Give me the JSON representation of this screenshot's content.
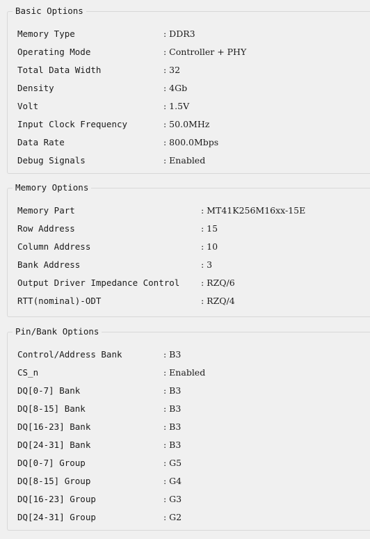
{
  "basic_options": {
    "title": "Basic Options",
    "rows": [
      {
        "label": "Memory Type",
        "value": ": DDR3"
      },
      {
        "label": "Operating Mode",
        "value": ": Controller + PHY"
      },
      {
        "label": "Total Data Width",
        "value": ": 32"
      },
      {
        "label": "Density",
        "value": ": 4Gb"
      },
      {
        "label": "Volt",
        "value": ": 1.5V"
      },
      {
        "label": "Input Clock Frequency",
        "value": ": 50.0MHz"
      },
      {
        "label": "Data Rate",
        "value": ": 800.0Mbps"
      },
      {
        "label": "Debug Signals",
        "value": ": Enabled"
      }
    ]
  },
  "memory_options": {
    "title": "Memory Options",
    "rows": [
      {
        "label": "Memory Part",
        "value": ": MT41K256M16xx-15E"
      },
      {
        "label": "Row Address",
        "value": ": 15"
      },
      {
        "label": "Column Address",
        "value": ": 10"
      },
      {
        "label": "Bank Address",
        "value": ": 3"
      },
      {
        "label": "Output Driver Impedance Control",
        "value": ": RZQ/6"
      },
      {
        "label": "RTT(nominal)-ODT",
        "value": ": RZQ/4"
      }
    ]
  },
  "pin_bank_options": {
    "title": "Pin/Bank Options",
    "rows": [
      {
        "label": "Control/Address Bank",
        "value": ": B3"
      },
      {
        "label": "CS_n",
        "value": ": Enabled"
      },
      {
        "label": "DQ[0-7] Bank",
        "value": ": B3"
      },
      {
        "label": "DQ[8-15] Bank",
        "value": ": B3"
      },
      {
        "label": "DQ[16-23] Bank",
        "value": ": B3"
      },
      {
        "label": "DQ[24-31] Bank",
        "value": ": B3"
      },
      {
        "label": "DQ[0-7] Group",
        "value": ": G5"
      },
      {
        "label": "DQ[8-15] Group",
        "value": ": G4"
      },
      {
        "label": "DQ[16-23] Group",
        "value": ": G3"
      },
      {
        "label": "DQ[24-31] Group",
        "value": ": G2"
      }
    ]
  }
}
